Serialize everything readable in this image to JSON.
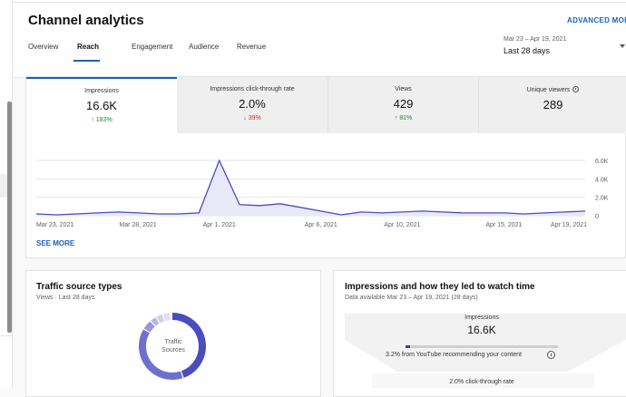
{
  "header": {
    "title": "Channel analytics",
    "advanced_mode": "ADVANCED MODE",
    "tabs": [
      {
        "label": "Overview"
      },
      {
        "label": "Reach",
        "active": true
      },
      {
        "label": "Engagement"
      },
      {
        "label": "Audience"
      },
      {
        "label": "Revenue"
      }
    ],
    "date_range": {
      "dates": "Mar 23 – Apr 19, 2021",
      "label": "Last 28 days"
    }
  },
  "metrics": [
    {
      "label": "Impressions",
      "value": "16.6K",
      "change": "183%",
      "direction": "up",
      "selected": true
    },
    {
      "label": "Impressions click-through rate",
      "value": "2.0%",
      "change": "39%",
      "direction": "down"
    },
    {
      "label": "Views",
      "value": "429",
      "change": "81%",
      "direction": "up"
    },
    {
      "label": "Unique viewers",
      "value": "289",
      "info_icon": "info-icon"
    }
  ],
  "chart_data": {
    "type": "area",
    "x": [
      "Mar 23, 2021",
      "Mar 24",
      "Mar 25",
      "Mar 26",
      "Mar 27",
      "Mar 28, 2021",
      "Mar 29",
      "Mar 30",
      "Mar 31",
      "Apr 1, 2021",
      "Apr 2",
      "Apr 3",
      "Apr 4",
      "Apr 5",
      "Apr 6, 2021",
      "Apr 7",
      "Apr 8",
      "Apr 9",
      "Apr 10, 2021",
      "Apr 11",
      "Apr 12",
      "Apr 13",
      "Apr 14",
      "Apr 15, 2021",
      "Apr 16",
      "Apr 17",
      "Apr 18",
      "Apr 19, 2021"
    ],
    "series": [
      {
        "values": [
          200,
          100,
          200,
          300,
          400,
          300,
          200,
          200,
          300,
          6000,
          1200,
          1100,
          1300,
          900,
          500,
          100,
          400,
          300,
          400,
          500,
          400,
          300,
          300,
          300,
          200,
          300,
          400,
          500
        ]
      }
    ],
    "x_tick_labels": [
      "Mar 23, 2021",
      "Mar 28, 2021",
      "Apr 1, 2021",
      "Apr 6, 2021",
      "Apr 10, 2021",
      "Apr 15, 2021",
      "Apr 19, 2021"
    ],
    "y_tick_labels": [
      "6.0K",
      "4.0K",
      "2.0K",
      "0"
    ],
    "ylim": [
      0,
      6000
    ],
    "grid": true,
    "colors": {
      "line": "#4a4cbf",
      "fill": "#e8e8f6"
    }
  },
  "see_more": "SEE MORE",
  "traffic": {
    "title": "Traffic source types",
    "subtitle": "Views · Last 28 days",
    "donut_label_1": "Traffic",
    "donut_label_2": "Sources",
    "colors": [
      "#4a4cbf",
      "#6e70cf",
      "#9597dc",
      "#b6b7e6",
      "#cfd0ee",
      "#e0e0f4"
    ]
  },
  "funnel": {
    "title": "Impressions and how they led to watch time",
    "subtitle": "Data available Mar 23 – Apr 19, 2021 (28 days)",
    "impressions_label": "Impressions",
    "impressions_value": "16.6K",
    "youtube_share": 0.032,
    "note": "3.2% from YouTube recommending your content",
    "ctr_label": "2.0% click-through rate"
  }
}
